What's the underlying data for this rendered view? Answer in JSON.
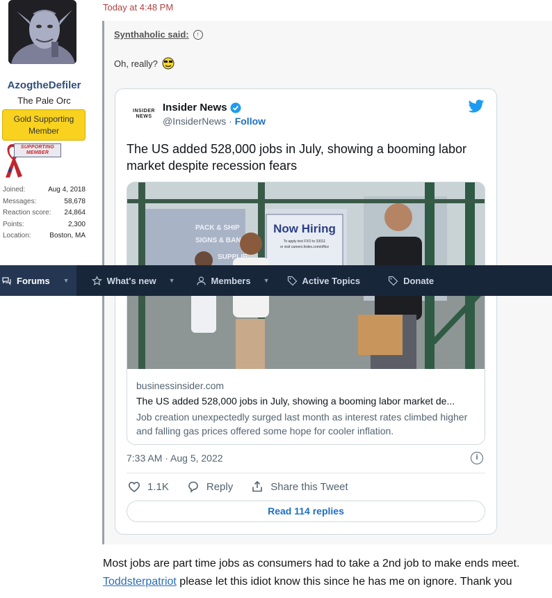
{
  "user": {
    "name": "AzogtheDefiler",
    "title": "The Pale Orc",
    "badge": "Gold Supporting Member",
    "supporting_tag": "SUPPORTING MEMBER",
    "stats": [
      {
        "label": "Joined:",
        "value": "Aug 4, 2018"
      },
      {
        "label": "Messages:",
        "value": "58,678"
      },
      {
        "label": "Reaction score:",
        "value": "24,864"
      },
      {
        "label": "Points:",
        "value": "2,300"
      },
      {
        "label": "Location:",
        "value": "Boston, MA"
      }
    ]
  },
  "post": {
    "date": "Today at 4:48 PM",
    "quote": {
      "author": "Synthaholic said:",
      "text": "Oh, really?"
    },
    "body_line1": "Most jobs are part time jobs as consumers had to take a 2nd job to make ends meet.",
    "mention": "Toddsterpatriot",
    "body_line2_rest": " please let this idiot know this since he has me on ignore. Thank you"
  },
  "tweet": {
    "logo_text_1": "INSIDER",
    "logo_text_2": "NEWS",
    "name": "Insider News",
    "handle": "@InsiderNews",
    "separator": " · ",
    "follow": "Follow",
    "text": "The US added 528,000 jobs in July, showing a booming labor market despite recession fears",
    "photo_sign_1": "Now Hiring",
    "photo_sign_2": "To apply text FXO to 33011",
    "photo_sign_3": "or visit careers.fedex.com/office",
    "photo_shop": "PACK & SHIP",
    "photo_shop2": "SIGNS & BANN",
    "photo_shop3": "SUPPLIE",
    "link": {
      "domain": "businessinsider.com",
      "title": "The US added 528,000 jobs in July, showing a booming labor market de...",
      "description": "Job creation unexpectedly surged last month as interest rates climbed higher and falling gas prices offered some hope for cooler inflation."
    },
    "time": "7:33 AM · Aug 5, 2022",
    "info_glyph": "i",
    "likes": "1.1K",
    "reply": "Reply",
    "share": "Share this Tweet",
    "read_replies": "Read 114 replies"
  },
  "nav": {
    "tabs": [
      {
        "label": "Forums",
        "icon": "chat-icon",
        "active": true,
        "caret": true
      },
      {
        "label": "What's new",
        "icon": "star-icon",
        "active": false,
        "caret": true
      },
      {
        "label": "Members",
        "icon": "user-icon",
        "active": false,
        "caret": true
      },
      {
        "label": "Active Topics",
        "icon": "tag-icon",
        "active": false,
        "caret": false
      },
      {
        "label": "Donate",
        "icon": "tag-icon",
        "active": false,
        "caret": false
      }
    ]
  },
  "colors": {
    "navbar": "#18263a",
    "gold_badge": "#f8d21e",
    "link_blue": "#1d6fc4",
    "date_red": "#b0413e"
  }
}
